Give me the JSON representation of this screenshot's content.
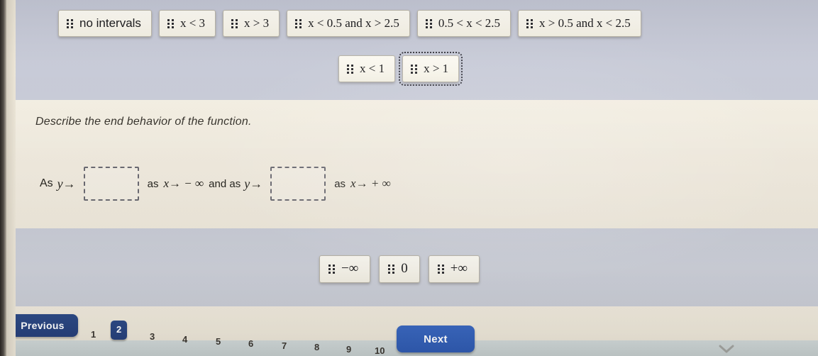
{
  "interval_bank": {
    "row1": [
      {
        "label": "no intervals",
        "kind": "text",
        "selected": false
      },
      {
        "label": "x < 3",
        "kind": "math",
        "selected": false
      },
      {
        "label": "x > 3",
        "kind": "math",
        "selected": false
      },
      {
        "label": "x < 0.5  and  x > 2.5",
        "kind": "math",
        "selected": false
      },
      {
        "label": "0.5 < x < 2.5",
        "kind": "math",
        "selected": false
      },
      {
        "label": "x > 0.5  and  x < 2.5",
        "kind": "math",
        "selected": false
      }
    ],
    "row2": [
      {
        "label": "x < 1",
        "kind": "math",
        "selected": false
      },
      {
        "label": "x > 1",
        "kind": "math",
        "selected": true
      }
    ]
  },
  "instruction": {
    "text": "Describe the end behavior of the function."
  },
  "answer_sentence": {
    "lead": "As",
    "y_arrow": "y→",
    "blank1_value": "",
    "mid1": "as",
    "limit1": "x→ − ∞",
    "conjunction": "and as",
    "y_arrow2": "y→",
    "blank2_value": "",
    "mid2": "as",
    "limit2": "x→ + ∞"
  },
  "answer_bank": {
    "tiles": [
      {
        "label": "−∞"
      },
      {
        "label": "0"
      },
      {
        "label": "+∞"
      }
    ]
  },
  "navigation": {
    "previous_label": "Previous",
    "next_label": "Next",
    "pages": [
      "1",
      "2",
      "3",
      "4",
      "5",
      "6",
      "7",
      "8",
      "9",
      "10"
    ],
    "active_page": "2"
  },
  "colors": {
    "panel": "#c7cad7",
    "paper": "#f1ebdf",
    "previous_button": "#27407a",
    "next_button": "#2f5ab0",
    "tile": "#f7f4ea"
  },
  "icons": {
    "drag_handle": "drag-handle-icon",
    "chevron_down": "chevron-down-icon"
  }
}
